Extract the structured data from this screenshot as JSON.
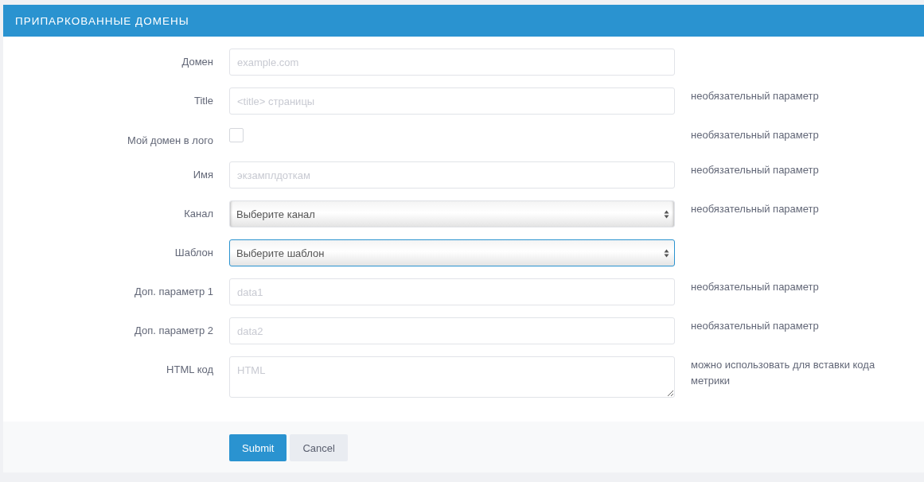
{
  "panel": {
    "title": "ПРИПАРКОВАННЫЕ ДОМЕНЫ"
  },
  "fields": [
    {
      "kind": "text",
      "label": "Домен",
      "placeholder": "example.com"
    },
    {
      "kind": "text",
      "label": "Title",
      "placeholder": "<title> страницы",
      "help": "необязательный параметр"
    },
    {
      "kind": "checkbox",
      "label": "Мой домен в лого",
      "checked": false,
      "help": "необязательный параметр"
    },
    {
      "kind": "text",
      "label": "Имя",
      "placeholder": "экзамплдоткам",
      "help": "необязательный параметр"
    },
    {
      "kind": "select",
      "label": "Канал",
      "value": "Выберите канал",
      "focused": false,
      "help": "необязательный параметр"
    },
    {
      "kind": "select",
      "label": "Шаблон",
      "value": "Выберите шаблон",
      "focused": true
    },
    {
      "kind": "text",
      "label": "Доп. параметр 1",
      "placeholder": "data1",
      "help": "необязательный параметр"
    },
    {
      "kind": "text",
      "label": "Доп. параметр 2",
      "placeholder": "data2",
      "help": "необязательный параметр"
    },
    {
      "kind": "textarea",
      "label": "HTML код",
      "placeholder": "HTML",
      "help": "можно использовать для вставки кода метрики"
    }
  ],
  "buttons": [
    {
      "kind": "primary",
      "label": "Submit"
    },
    {
      "kind": "default",
      "label": "Cancel"
    }
  ]
}
